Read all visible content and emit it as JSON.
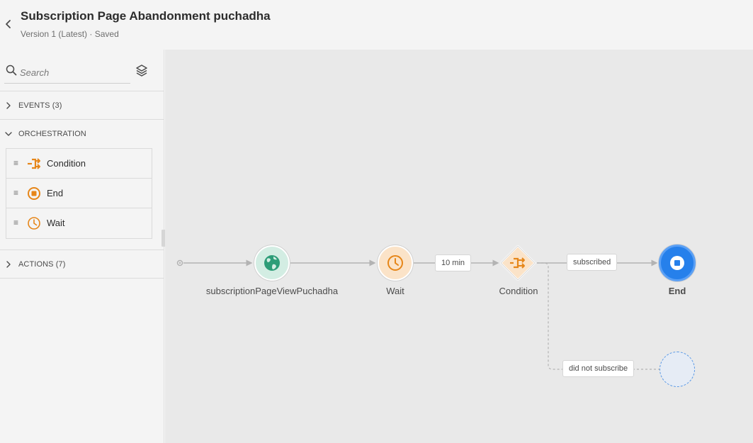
{
  "header": {
    "title": "Subscription Page Abandonment puchadha",
    "subtitle": "Version 1 (Latest) · Saved",
    "back_icon": "chevron-left-icon"
  },
  "sidebar": {
    "search_placeholder": "Search",
    "sections": {
      "events": {
        "label": "EVENTS (3)",
        "expanded": false
      },
      "orchestration": {
        "label": "ORCHESTRATION",
        "expanded": true,
        "items": [
          {
            "label": "Condition",
            "icon": "condition-icon"
          },
          {
            "label": "End",
            "icon": "end-icon"
          },
          {
            "label": "Wait",
            "icon": "clock-icon"
          }
        ]
      },
      "actions": {
        "label": "ACTIONS (7)",
        "expanded": false
      }
    }
  },
  "canvas": {
    "nodes": [
      {
        "label": "subscriptionPageViewPuchadha",
        "type": "event",
        "icon": "globe-icon"
      },
      {
        "label": "Wait",
        "type": "wait",
        "icon": "clock-icon"
      },
      {
        "label": "Condition",
        "type": "condition",
        "icon": "condition-icon"
      },
      {
        "label": "End",
        "type": "end",
        "icon": "stop-icon"
      }
    ],
    "edge_labels": {
      "wait_duration": "10 min",
      "subscribed": "subscribed",
      "did_not_subscribe": "did not subscribe"
    }
  },
  "colors": {
    "accent_orange": "#e68619",
    "event_green": "#2d9d78",
    "end_blue": "#2680eb"
  }
}
